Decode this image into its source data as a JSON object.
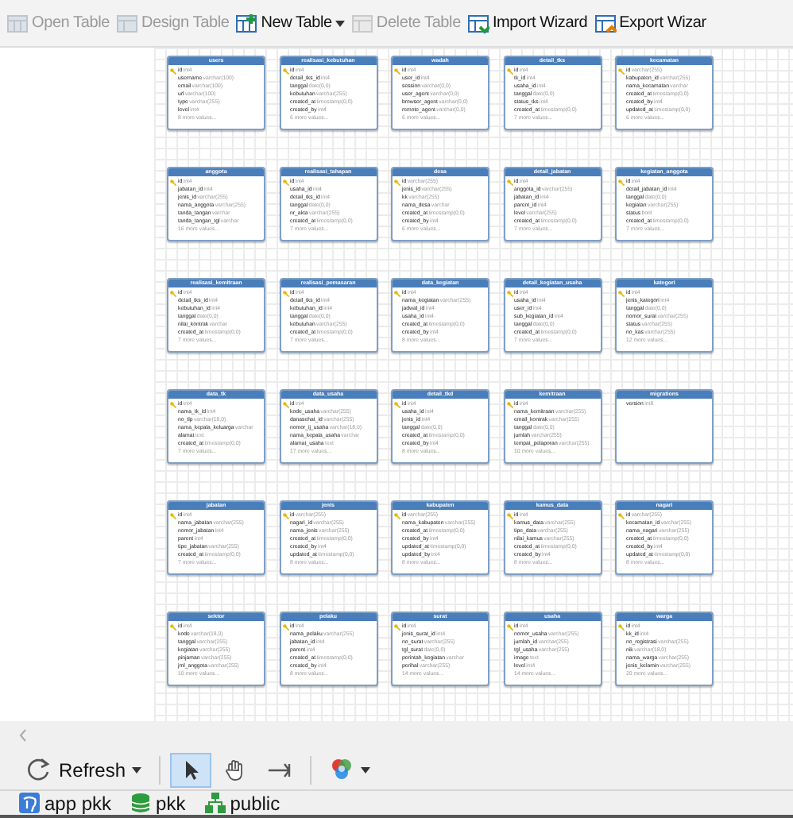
{
  "toolbar": [
    {
      "kind": "open",
      "label": "Open Table",
      "disabled": true,
      "dropdown": false
    },
    {
      "kind": "design",
      "label": "Design Table",
      "disabled": true,
      "dropdown": false
    },
    {
      "kind": "new",
      "label": "New Table",
      "disabled": false,
      "dropdown": true
    },
    {
      "kind": "delete",
      "label": "Delete Table",
      "disabled": true,
      "dropdown": false
    },
    {
      "kind": "import",
      "label": "Import Wizard",
      "disabled": false,
      "dropdown": false
    },
    {
      "kind": "export",
      "label": "Export Wizar",
      "disabled": false,
      "dropdown": false
    }
  ],
  "tables": [
    {
      "name": "users",
      "columns": [
        {
          "name": "id",
          "type": "int4",
          "key": true
        },
        {
          "name": "username",
          "type": "varchar(100)",
          "key": false
        },
        {
          "name": "email",
          "type": "varchar(100)",
          "key": false
        },
        {
          "name": "url",
          "type": "varchar(100)",
          "key": false
        },
        {
          "name": "type",
          "type": "varchar(255)",
          "key": false
        },
        {
          "name": "level",
          "type": "int4",
          "key": false
        }
      ],
      "more": "8 more values..."
    },
    {
      "name": "realisasi_kebutuhan",
      "columns": [
        {
          "name": "id",
          "type": "int4",
          "key": true
        },
        {
          "name": "detail_tks_id",
          "type": "int4",
          "key": false
        },
        {
          "name": "tanggal",
          "type": "date(0,0)",
          "key": false
        },
        {
          "name": "kebutuhan",
          "type": "varchar(255)",
          "key": false
        },
        {
          "name": "created_at",
          "type": "timestamp(0,0)",
          "key": false
        },
        {
          "name": "created_by",
          "type": "int4",
          "key": false
        }
      ],
      "more": "6 more values..."
    },
    {
      "name": "wadah",
      "columns": [
        {
          "name": "id",
          "type": "int4",
          "key": true
        },
        {
          "name": "user_id",
          "type": "int4",
          "key": false
        },
        {
          "name": "session",
          "type": "varchar(0,0)",
          "key": false
        },
        {
          "name": "user_agent",
          "type": "varchar(0,0)",
          "key": false
        },
        {
          "name": "browser_agent",
          "type": "varchar(0,0)",
          "key": false
        },
        {
          "name": "remote_agent",
          "type": "varchar(0,0)",
          "key": false
        }
      ],
      "more": "6 more values..."
    },
    {
      "name": "detail_tks",
      "columns": [
        {
          "name": "id",
          "type": "int4",
          "key": true
        },
        {
          "name": "tk_id",
          "type": "int4",
          "key": false
        },
        {
          "name": "usaha_id",
          "type": "int4",
          "key": false
        },
        {
          "name": "tanggal",
          "type": "date(0,0)",
          "key": false
        },
        {
          "name": "status_tks",
          "type": "int4",
          "key": false
        },
        {
          "name": "created_at",
          "type": "timestamp(0,0)",
          "key": false
        }
      ],
      "more": "7 more values..."
    },
    {
      "name": "kecamatan",
      "columns": [
        {
          "name": "id",
          "type": "varchar(255)",
          "key": true
        },
        {
          "name": "kabupaten_id",
          "type": "varchar(255)",
          "key": false
        },
        {
          "name": "nama_kecamatan",
          "type": "varchar",
          "key": false
        },
        {
          "name": "created_at",
          "type": "timestamp(0,0)",
          "key": false
        },
        {
          "name": "created_by",
          "type": "int4",
          "key": false
        },
        {
          "name": "updated_at",
          "type": "timestamp(0,0)",
          "key": false
        }
      ],
      "more": "6 more values..."
    },
    {
      "name": "anggota",
      "columns": [
        {
          "name": "id",
          "type": "int4",
          "key": true
        },
        {
          "name": "jabatan_id",
          "type": "int4",
          "key": false
        },
        {
          "name": "jenis_id",
          "type": "varchar(255)",
          "key": false
        },
        {
          "name": "nama_anggota",
          "type": "varchar(255)",
          "key": false
        },
        {
          "name": "tanda_tangan",
          "type": "varchar",
          "key": false
        },
        {
          "name": "tanda_tangan_tgl",
          "type": "varchar",
          "key": false
        }
      ],
      "more": "16 more values..."
    },
    {
      "name": "realisasi_tahapan",
      "columns": [
        {
          "name": "id",
          "type": "int4",
          "key": true
        },
        {
          "name": "usaha_id",
          "type": "int4",
          "key": false
        },
        {
          "name": "detail_tks_id",
          "type": "int4",
          "key": false
        },
        {
          "name": "tanggal",
          "type": "date(0,0)",
          "key": false
        },
        {
          "name": "nr_akta",
          "type": "varchar(255)",
          "key": false
        },
        {
          "name": "created_at",
          "type": "timestamp(0,0)",
          "key": false
        }
      ],
      "more": "7 more values..."
    },
    {
      "name": "desa",
      "columns": [
        {
          "name": "id",
          "type": "varchar(255)",
          "key": true
        },
        {
          "name": "jenis_id",
          "type": "varchar(255)",
          "key": false
        },
        {
          "name": "kk",
          "type": "varchar(255)",
          "key": false
        },
        {
          "name": "nama_desa",
          "type": "varchar",
          "key": false
        },
        {
          "name": "created_at",
          "type": "timestamp(0,0)",
          "key": false
        },
        {
          "name": "created_by",
          "type": "int4",
          "key": false
        }
      ],
      "more": "6 more values..."
    },
    {
      "name": "detail_jabatan",
      "columns": [
        {
          "name": "id",
          "type": "int4",
          "key": true
        },
        {
          "name": "anggota_id",
          "type": "varchar(255)",
          "key": false
        },
        {
          "name": "jabatan_id",
          "type": "int4",
          "key": false
        },
        {
          "name": "parent_id",
          "type": "int4",
          "key": false
        },
        {
          "name": "level",
          "type": "varchar(255)",
          "key": false
        },
        {
          "name": "created_at",
          "type": "timestamp(0,0)",
          "key": false
        }
      ],
      "more": "7 more values..."
    },
    {
      "name": "kegiatan_anggota",
      "columns": [
        {
          "name": "id",
          "type": "int4",
          "key": true
        },
        {
          "name": "detail_jabatan_id",
          "type": "int4",
          "key": false
        },
        {
          "name": "tanggal",
          "type": "date(0,0)",
          "key": false
        },
        {
          "name": "kegiatan",
          "type": "varchar(255)",
          "key": false
        },
        {
          "name": "status",
          "type": "bool",
          "key": false
        },
        {
          "name": "created_at",
          "type": "timestamp(0,0)",
          "key": false
        }
      ],
      "more": "7 more values..."
    },
    {
      "name": "realisasi_kemitraan",
      "columns": [
        {
          "name": "id",
          "type": "int4",
          "key": true
        },
        {
          "name": "detail_tks_id",
          "type": "int4",
          "key": false
        },
        {
          "name": "kebutuhan_id",
          "type": "int4",
          "key": false
        },
        {
          "name": "tanggal",
          "type": "date(0,0)",
          "key": false
        },
        {
          "name": "nilai_kontrak",
          "type": "varchar",
          "key": false
        },
        {
          "name": "created_at",
          "type": "timestamp(0,0)",
          "key": false
        }
      ],
      "more": "7 more values..."
    },
    {
      "name": "realisasi_pemasaran",
      "columns": [
        {
          "name": "id",
          "type": "int4",
          "key": true
        },
        {
          "name": "detail_tks_id",
          "type": "int4",
          "key": false
        },
        {
          "name": "kebutuhan_id",
          "type": "int4",
          "key": false
        },
        {
          "name": "tanggal",
          "type": "date(0,0)",
          "key": false
        },
        {
          "name": "kebutuhan",
          "type": "varchar(255)",
          "key": false
        },
        {
          "name": "created_at",
          "type": "timestamp(0,0)",
          "key": false
        }
      ],
      "more": "7 more values..."
    },
    {
      "name": "data_kegiatan",
      "columns": [
        {
          "name": "id",
          "type": "int4",
          "key": true
        },
        {
          "name": "nama_kegiatan",
          "type": "varchar(255)",
          "key": false
        },
        {
          "name": "jadwal_id",
          "type": "int4",
          "key": false
        },
        {
          "name": "usaha_id",
          "type": "int4",
          "key": false
        },
        {
          "name": "created_at",
          "type": "timestamp(0,0)",
          "key": false
        },
        {
          "name": "created_by",
          "type": "int4",
          "key": false
        }
      ],
      "more": "8 more values..."
    },
    {
      "name": "detail_kegiatan_usaha",
      "columns": [
        {
          "name": "id",
          "type": "int4",
          "key": true
        },
        {
          "name": "usaha_id",
          "type": "int4",
          "key": false
        },
        {
          "name": "user_id",
          "type": "int4",
          "key": false
        },
        {
          "name": "sub_kegiatan_id",
          "type": "int4",
          "key": false
        },
        {
          "name": "tanggal",
          "type": "date(0,0)",
          "key": false
        },
        {
          "name": "created_at",
          "type": "timestamp(0,0)",
          "key": false
        }
      ],
      "more": "7 more values..."
    },
    {
      "name": "kategori",
      "columns": [
        {
          "name": "id",
          "type": "int4",
          "key": true
        },
        {
          "name": "jenis_kategori",
          "type": "int4",
          "key": false
        },
        {
          "name": "tanggal",
          "type": "date(0,0)",
          "key": false
        },
        {
          "name": "nomor_surat",
          "type": "varchar(255)",
          "key": false
        },
        {
          "name": "status",
          "type": "varchar(255)",
          "key": false
        },
        {
          "name": "no_kas",
          "type": "varchar(255)",
          "key": false
        }
      ],
      "more": "12 more values..."
    },
    {
      "name": "data_tk",
      "columns": [
        {
          "name": "id",
          "type": "int4",
          "key": true
        },
        {
          "name": "nama_tk_id",
          "type": "int4",
          "key": false
        },
        {
          "name": "no_tlp",
          "type": "varchar(18,0)",
          "key": false
        },
        {
          "name": "nama_kepala_keluarga",
          "type": "varchar",
          "key": false
        },
        {
          "name": "alamat",
          "type": "text",
          "key": false
        },
        {
          "name": "created_at",
          "type": "timestamp(0,0)",
          "key": false
        }
      ],
      "more": "7 more values..."
    },
    {
      "name": "data_usaha",
      "columns": [
        {
          "name": "id",
          "type": "int4",
          "key": true
        },
        {
          "name": "kode_usaha",
          "type": "varchar(255)",
          "key": false
        },
        {
          "name": "danasehat_id",
          "type": "varchar(255)",
          "key": false
        },
        {
          "name": "nomor_ij_usaha",
          "type": "varchar(18,0)",
          "key": false
        },
        {
          "name": "nama_kepala_usaha",
          "type": "varchar",
          "key": false
        },
        {
          "name": "alamat_usaha",
          "type": "text",
          "key": false
        }
      ],
      "more": "17 more values..."
    },
    {
      "name": "detail_tkd",
      "columns": [
        {
          "name": "id",
          "type": "int4",
          "key": true
        },
        {
          "name": "usaha_id",
          "type": "int4",
          "key": false
        },
        {
          "name": "jenis_id",
          "type": "int4",
          "key": false
        },
        {
          "name": "tanggal",
          "type": "date(0,0)",
          "key": false
        },
        {
          "name": "created_at",
          "type": "timestamp(0,0)",
          "key": false
        },
        {
          "name": "created_by",
          "type": "int4",
          "key": false
        }
      ],
      "more": "8 more values..."
    },
    {
      "name": "kemitraan",
      "columns": [
        {
          "name": "id",
          "type": "int4",
          "key": true
        },
        {
          "name": "nama_kemitraan",
          "type": "varchar(255)",
          "key": false
        },
        {
          "name": "email_kontrak",
          "type": "varchar(255)",
          "key": false
        },
        {
          "name": "tanggal",
          "type": "date(0,0)",
          "key": false
        },
        {
          "name": "jumlah",
          "type": "varchar(255)",
          "key": false
        },
        {
          "name": "tempat_pelaporan",
          "type": "varchar(255)",
          "key": false
        }
      ],
      "more": "10 more values..."
    },
    {
      "name": "migrations",
      "columns": [
        {
          "name": "version",
          "type": "int8",
          "key": false
        }
      ]
    },
    {
      "name": "jabatan",
      "columns": [
        {
          "name": "id",
          "type": "int4",
          "key": true
        },
        {
          "name": "nama_jabatan",
          "type": "varchar(255)",
          "key": false
        },
        {
          "name": "nomor_jabatan",
          "type": "int4",
          "key": false
        },
        {
          "name": "parent",
          "type": "int4",
          "key": false
        },
        {
          "name": "tipe_jabatan",
          "type": "varchar(255)",
          "key": false
        },
        {
          "name": "created_at",
          "type": "timestamp(0,0)",
          "key": false
        }
      ],
      "more": "7 more values..."
    },
    {
      "name": "jenis",
      "columns": [
        {
          "name": "id",
          "type": "varchar(255)",
          "key": true
        },
        {
          "name": "nagari_id",
          "type": "varchar(255)",
          "key": false
        },
        {
          "name": "nama_jenis",
          "type": "varchar(255)",
          "key": false
        },
        {
          "name": "created_at",
          "type": "timestamp(0,0)",
          "key": false
        },
        {
          "name": "created_by",
          "type": "int4",
          "key": false
        },
        {
          "name": "updated_at",
          "type": "timestamp(0,0)",
          "key": false
        }
      ],
      "more": "8 more values..."
    },
    {
      "name": "kabupaten",
      "columns": [
        {
          "name": "id",
          "type": "varchar(255)",
          "key": true
        },
        {
          "name": "nama_kabupaten",
          "type": "varchar(255)",
          "key": false
        },
        {
          "name": "created_at",
          "type": "timestamp(0,0)",
          "key": false
        },
        {
          "name": "created_by",
          "type": "int4",
          "key": false
        },
        {
          "name": "updated_at",
          "type": "timestamp(0,0)",
          "key": false
        },
        {
          "name": "updated_by",
          "type": "int4",
          "key": false
        }
      ],
      "more": "8 more values..."
    },
    {
      "name": "kamus_data",
      "columns": [
        {
          "name": "id",
          "type": "int4",
          "key": true
        },
        {
          "name": "kamus_data",
          "type": "varchar(255)",
          "key": false
        },
        {
          "name": "tipe_data",
          "type": "varchar(255)",
          "key": false
        },
        {
          "name": "nilai_kamus",
          "type": "varchar(255)",
          "key": false
        },
        {
          "name": "created_at",
          "type": "timestamp(0,0)",
          "key": false
        },
        {
          "name": "created_by",
          "type": "int4",
          "key": false
        }
      ],
      "more": "8 more values..."
    },
    {
      "name": "nagari",
      "columns": [
        {
          "name": "id",
          "type": "varchar(255)",
          "key": true
        },
        {
          "name": "kecamatan_id",
          "type": "varchar(255)",
          "key": false
        },
        {
          "name": "nama_nagari",
          "type": "varchar(255)",
          "key": false
        },
        {
          "name": "created_at",
          "type": "timestamp(0,0)",
          "key": false
        },
        {
          "name": "created_by",
          "type": "int4",
          "key": false
        },
        {
          "name": "updated_at",
          "type": "timestamp(0,0)",
          "key": false
        }
      ],
      "more": "8 more values..."
    },
    {
      "name": "sektor",
      "columns": [
        {
          "name": "id",
          "type": "int4",
          "key": true
        },
        {
          "name": "kode",
          "type": "varchar(18,0)",
          "key": false
        },
        {
          "name": "tanggal",
          "type": "varchar(255)",
          "key": false
        },
        {
          "name": "kegiatan",
          "type": "varchar(255)",
          "key": false
        },
        {
          "name": "pinjaman",
          "type": "varchar(255)",
          "key": false
        },
        {
          "name": "jml_anggota",
          "type": "varchar(255)",
          "key": false
        }
      ],
      "more": "10 more values..."
    },
    {
      "name": "pelaku",
      "columns": [
        {
          "name": "id",
          "type": "int4",
          "key": true
        },
        {
          "name": "nama_pelaku",
          "type": "varchar(255)",
          "key": false
        },
        {
          "name": "jabatan_id",
          "type": "int4",
          "key": false
        },
        {
          "name": "parent",
          "type": "int4",
          "key": false
        },
        {
          "name": "created_at",
          "type": "timestamp(0,0)",
          "key": false
        },
        {
          "name": "created_by",
          "type": "int4",
          "key": false
        }
      ],
      "more": "8 more values..."
    },
    {
      "name": "surat",
      "columns": [
        {
          "name": "id",
          "type": "int4",
          "key": true
        },
        {
          "name": "jenis_surat_id",
          "type": "int4",
          "key": false
        },
        {
          "name": "no_surat",
          "type": "varchar(255)",
          "key": false
        },
        {
          "name": "tgl_surat",
          "type": "date(0,0)",
          "key": false
        },
        {
          "name": "perintah_kegiatan",
          "type": "varchar",
          "key": false
        },
        {
          "name": "perihal",
          "type": "varchar(255)",
          "key": false
        }
      ],
      "more": "14 more values..."
    },
    {
      "name": "usaha",
      "columns": [
        {
          "name": "id",
          "type": "int4",
          "key": true
        },
        {
          "name": "nomor_usaha",
          "type": "varchar(255)",
          "key": false
        },
        {
          "name": "jumlah_id",
          "type": "varchar(255)",
          "key": false
        },
        {
          "name": "tgl_usaha",
          "type": "varchar(255)",
          "key": false
        },
        {
          "name": "image",
          "type": "text",
          "key": false
        },
        {
          "name": "level",
          "type": "int4",
          "key": false
        }
      ],
      "more": "14 more values..."
    },
    {
      "name": "warga",
      "columns": [
        {
          "name": "id",
          "type": "int4",
          "key": true
        },
        {
          "name": "kk_id",
          "type": "int4",
          "key": false
        },
        {
          "name": "no_registrasi",
          "type": "varchar(255)",
          "key": false
        },
        {
          "name": "nik",
          "type": "varchar(18,0)",
          "key": false
        },
        {
          "name": "nama_warga",
          "type": "varchar(255)",
          "key": false
        },
        {
          "name": "jenis_kelamin",
          "type": "varchar(255)",
          "key": false
        }
      ],
      "more": "20 more values..."
    }
  ],
  "bottom_toolbar": [
    {
      "kind": "refresh",
      "label": "Refresh",
      "selected": false
    },
    {
      "kind": "pointer",
      "selected": true
    },
    {
      "kind": "hand",
      "selected": false
    },
    {
      "kind": "connector",
      "selected": false
    },
    {
      "kind": "color",
      "selected": false
    }
  ],
  "status_bar": [
    {
      "kind": "connection",
      "label": "app pkk"
    },
    {
      "kind": "database",
      "label": "pkk"
    },
    {
      "kind": "schema",
      "label": "public"
    }
  ]
}
